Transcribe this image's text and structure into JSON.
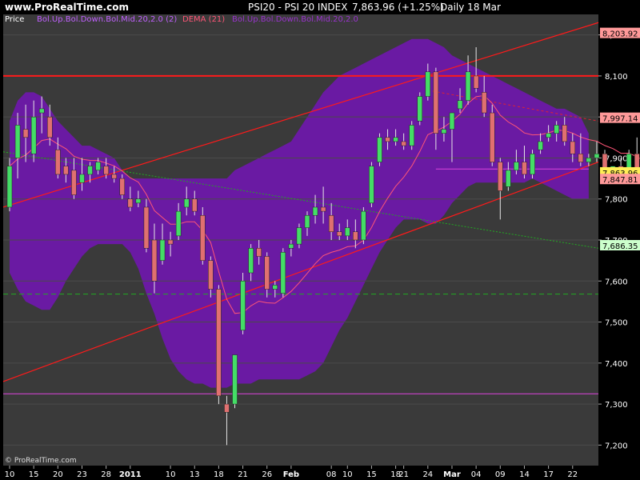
{
  "header": {
    "site": "www.ProRealTime.com",
    "instrument": "PSI20 - PSI 20 INDEX",
    "change": "7,863.96 (+1.25%)",
    "period": "Daily  18 Mar"
  },
  "legend": {
    "price": "Price",
    "bb_label": "Bol.Up.Bol.Down.Bol.Mid.20,2.0 (2)",
    "dema_label": "DEMA (21)",
    "bb2_label": "Bol.Up.Bol.Down.Bol.Mid.20,2.0"
  },
  "copyright": "© ProRealTime.com",
  "colors": {
    "bg": "#3a3a3a",
    "band": "#6a1aa3",
    "up": "#44dd66",
    "down": "#e07070",
    "red_line": "#ff1a1a",
    "magenta": "#dd44dd",
    "green_dash": "#22aa22"
  },
  "chart_data": {
    "type": "candlestick",
    "title": "PSI20 - PSI 20 INDEX",
    "ylim": [
      7150,
      8250
    ],
    "yticks": [
      7200,
      7300,
      7400,
      7500,
      7600,
      7700,
      7800,
      7900,
      8000,
      8100,
      8200
    ],
    "ytick_labels": [
      "7,200",
      "7,300",
      "7,400",
      "7,500",
      "7,600",
      "7,700",
      "7,800",
      "7,900",
      "8,000",
      "8,100",
      "8,200"
    ],
    "xticks": [
      {
        "label": "10",
        "i": 0
      },
      {
        "label": "15",
        "i": 3
      },
      {
        "label": "20",
        "i": 6
      },
      {
        "label": "23",
        "i": 9
      },
      {
        "label": "28",
        "i": 12
      },
      {
        "label": "2011",
        "i": 15
      },
      {
        "label": "10",
        "i": 20
      },
      {
        "label": "13",
        "i": 23
      },
      {
        "label": "18",
        "i": 26
      },
      {
        "label": "21",
        "i": 29
      },
      {
        "label": "26",
        "i": 32
      },
      {
        "label": "Feb",
        "i": 35
      },
      {
        "label": "08",
        "i": 40
      },
      {
        "label": "10",
        "i": 42
      },
      {
        "label": "15",
        "i": 45
      },
      {
        "label": "18",
        "i": 48
      },
      {
        "label": "21",
        "i": 49
      },
      {
        "label": "24",
        "i": 52
      },
      {
        "label": "Mar",
        "i": 55
      },
      {
        "label": "04",
        "i": 58
      },
      {
        "label": "09",
        "i": 61
      },
      {
        "label": "14",
        "i": 64
      },
      {
        "label": "17",
        "i": 67
      },
      {
        "label": "22",
        "i": 70
      }
    ],
    "price_tags": [
      {
        "value": 8203.92,
        "label": "8,203.92",
        "bg": "#ff9999",
        "fg": "#000000"
      },
      {
        "value": 7997.14,
        "label": "7,997.14",
        "bg": "#ff9999",
        "fg": "#000000"
      },
      {
        "value": 7863.96,
        "label": "7,863.96",
        "bg": "#ffee55",
        "fg": "#000000"
      },
      {
        "value": 7847.81,
        "label": "7,847.81",
        "bg": "#ff9999",
        "fg": "#000000"
      },
      {
        "value": 7686.35,
        "label": "7,686.35",
        "bg": "#ccffcc",
        "fg": "#000000"
      }
    ],
    "candles": [
      {
        "o": 7780,
        "h": 7900,
        "l": 7770,
        "c": 7880
      },
      {
        "o": 7900,
        "h": 8010,
        "l": 7850,
        "c": 7980
      },
      {
        "o": 7970,
        "h": 8030,
        "l": 7890,
        "c": 7950
      },
      {
        "o": 7910,
        "h": 8040,
        "l": 7890,
        "c": 8000
      },
      {
        "o": 8010,
        "h": 8050,
        "l": 7960,
        "c": 8020
      },
      {
        "o": 8000,
        "h": 8030,
        "l": 7930,
        "c": 7950
      },
      {
        "o": 7920,
        "h": 7950,
        "l": 7850,
        "c": 7860
      },
      {
        "o": 7880,
        "h": 7900,
        "l": 7840,
        "c": 7860
      },
      {
        "o": 7870,
        "h": 7900,
        "l": 7800,
        "c": 7810
      },
      {
        "o": 7840,
        "h": 7900,
        "l": 7820,
        "c": 7860
      },
      {
        "o": 7860,
        "h": 7890,
        "l": 7840,
        "c": 7880
      },
      {
        "o": 7870,
        "h": 7900,
        "l": 7860,
        "c": 7890
      },
      {
        "o": 7880,
        "h": 7900,
        "l": 7850,
        "c": 7860
      },
      {
        "o": 7860,
        "h": 7880,
        "l": 7840,
        "c": 7850
      },
      {
        "o": 7850,
        "h": 7860,
        "l": 7800,
        "c": 7810
      },
      {
        "o": 7800,
        "h": 7830,
        "l": 7770,
        "c": 7780
      },
      {
        "o": 7790,
        "h": 7820,
        "l": 7780,
        "c": 7800
      },
      {
        "o": 7780,
        "h": 7800,
        "l": 7670,
        "c": 7680
      },
      {
        "o": 7700,
        "h": 7740,
        "l": 7570,
        "c": 7600
      },
      {
        "o": 7650,
        "h": 7740,
        "l": 7640,
        "c": 7700
      },
      {
        "o": 7700,
        "h": 7720,
        "l": 7660,
        "c": 7690
      },
      {
        "o": 7710,
        "h": 7790,
        "l": 7700,
        "c": 7770
      },
      {
        "o": 7780,
        "h": 7830,
        "l": 7760,
        "c": 7800
      },
      {
        "o": 7800,
        "h": 7820,
        "l": 7760,
        "c": 7770
      },
      {
        "o": 7760,
        "h": 7780,
        "l": 7640,
        "c": 7650
      },
      {
        "o": 7650,
        "h": 7660,
        "l": 7560,
        "c": 7580
      },
      {
        "o": 7580,
        "h": 7590,
        "l": 7300,
        "c": 7320
      },
      {
        "o": 7300,
        "h": 7320,
        "l": 7200,
        "c": 7280
      },
      {
        "o": 7300,
        "h": 7420,
        "l": 7290,
        "c": 7420
      },
      {
        "o": 7480,
        "h": 7620,
        "l": 7470,
        "c": 7600
      },
      {
        "o": 7620,
        "h": 7690,
        "l": 7600,
        "c": 7680
      },
      {
        "o": 7680,
        "h": 7700,
        "l": 7640,
        "c": 7660
      },
      {
        "o": 7660,
        "h": 7670,
        "l": 7560,
        "c": 7580
      },
      {
        "o": 7580,
        "h": 7600,
        "l": 7560,
        "c": 7590
      },
      {
        "o": 7570,
        "h": 7680,
        "l": 7560,
        "c": 7670
      },
      {
        "o": 7680,
        "h": 7700,
        "l": 7660,
        "c": 7690
      },
      {
        "o": 7690,
        "h": 7740,
        "l": 7680,
        "c": 7730
      },
      {
        "o": 7730,
        "h": 7770,
        "l": 7710,
        "c": 7760
      },
      {
        "o": 7760,
        "h": 7810,
        "l": 7740,
        "c": 7780
      },
      {
        "o": 7780,
        "h": 7830,
        "l": 7740,
        "c": 7770
      },
      {
        "o": 7760,
        "h": 7790,
        "l": 7700,
        "c": 7720
      },
      {
        "o": 7720,
        "h": 7740,
        "l": 7700,
        "c": 7710
      },
      {
        "o": 7710,
        "h": 7750,
        "l": 7700,
        "c": 7730
      },
      {
        "o": 7720,
        "h": 7750,
        "l": 7680,
        "c": 7700
      },
      {
        "o": 7700,
        "h": 7780,
        "l": 7690,
        "c": 7770
      },
      {
        "o": 7790,
        "h": 7890,
        "l": 7780,
        "c": 7880
      },
      {
        "o": 7890,
        "h": 7960,
        "l": 7880,
        "c": 7950
      },
      {
        "o": 7950,
        "h": 7970,
        "l": 7920,
        "c": 7940
      },
      {
        "o": 7940,
        "h": 7970,
        "l": 7930,
        "c": 7950
      },
      {
        "o": 7940,
        "h": 7960,
        "l": 7920,
        "c": 7930
      },
      {
        "o": 7930,
        "h": 7990,
        "l": 7920,
        "c": 7980
      },
      {
        "o": 7990,
        "h": 8060,
        "l": 7980,
        "c": 8050
      },
      {
        "o": 8050,
        "h": 8130,
        "l": 8040,
        "c": 8110
      },
      {
        "o": 8110,
        "h": 8120,
        "l": 7920,
        "c": 7960
      },
      {
        "o": 7960,
        "h": 8000,
        "l": 7940,
        "c": 7970
      },
      {
        "o": 7970,
        "h": 8010,
        "l": 7890,
        "c": 8010
      },
      {
        "o": 8020,
        "h": 8070,
        "l": 8010,
        "c": 8040
      },
      {
        "o": 8040,
        "h": 8150,
        "l": 8030,
        "c": 8110
      },
      {
        "o": 8100,
        "h": 8170,
        "l": 8060,
        "c": 8070
      },
      {
        "o": 8060,
        "h": 8100,
        "l": 8000,
        "c": 8010
      },
      {
        "o": 8010,
        "h": 8030,
        "l": 7880,
        "c": 7890
      },
      {
        "o": 7890,
        "h": 7900,
        "l": 7750,
        "c": 7820
      },
      {
        "o": 7830,
        "h": 7890,
        "l": 7820,
        "c": 7870
      },
      {
        "o": 7870,
        "h": 7920,
        "l": 7860,
        "c": 7890
      },
      {
        "o": 7890,
        "h": 7930,
        "l": 7850,
        "c": 7860
      },
      {
        "o": 7860,
        "h": 7920,
        "l": 7850,
        "c": 7910
      },
      {
        "o": 7920,
        "h": 7960,
        "l": 7910,
        "c": 7940
      },
      {
        "o": 7950,
        "h": 7980,
        "l": 7940,
        "c": 7960
      },
      {
        "o": 7960,
        "h": 7990,
        "l": 7940,
        "c": 7980
      },
      {
        "o": 7980,
        "h": 8000,
        "l": 7930,
        "c": 7940
      },
      {
        "o": 7940,
        "h": 7960,
        "l": 7890,
        "c": 7910
      },
      {
        "o": 7910,
        "h": 7960,
        "l": 7880,
        "c": 7890
      },
      {
        "o": 7890,
        "h": 7910,
        "l": 7880,
        "c": 7900
      },
      {
        "o": 7900,
        "h": 7940,
        "l": 7890,
        "c": 7910
      },
      {
        "o": 7910,
        "h": 7920,
        "l": 7870,
        "c": 7870
      },
      {
        "o": 7870,
        "h": 7880,
        "l": 7860,
        "c": 7880
      },
      {
        "o": 7880,
        "h": 7900,
        "l": 7840,
        "c": 7850
      },
      {
        "o": 7850,
        "h": 7920,
        "l": 7840,
        "c": 7910
      },
      {
        "o": 7910,
        "h": 7950,
        "l": 7850,
        "c": 7860
      },
      {
        "o": 7860,
        "h": 7880,
        "l": 7830,
        "c": 7840
      },
      {
        "o": 7840,
        "h": 7860,
        "l": 7800,
        "c": 7810
      },
      {
        "o": 7810,
        "h": 7830,
        "l": 7790,
        "c": 7800
      },
      {
        "o": 7790,
        "h": 7870,
        "l": 7780,
        "c": 7864
      }
    ]
  }
}
